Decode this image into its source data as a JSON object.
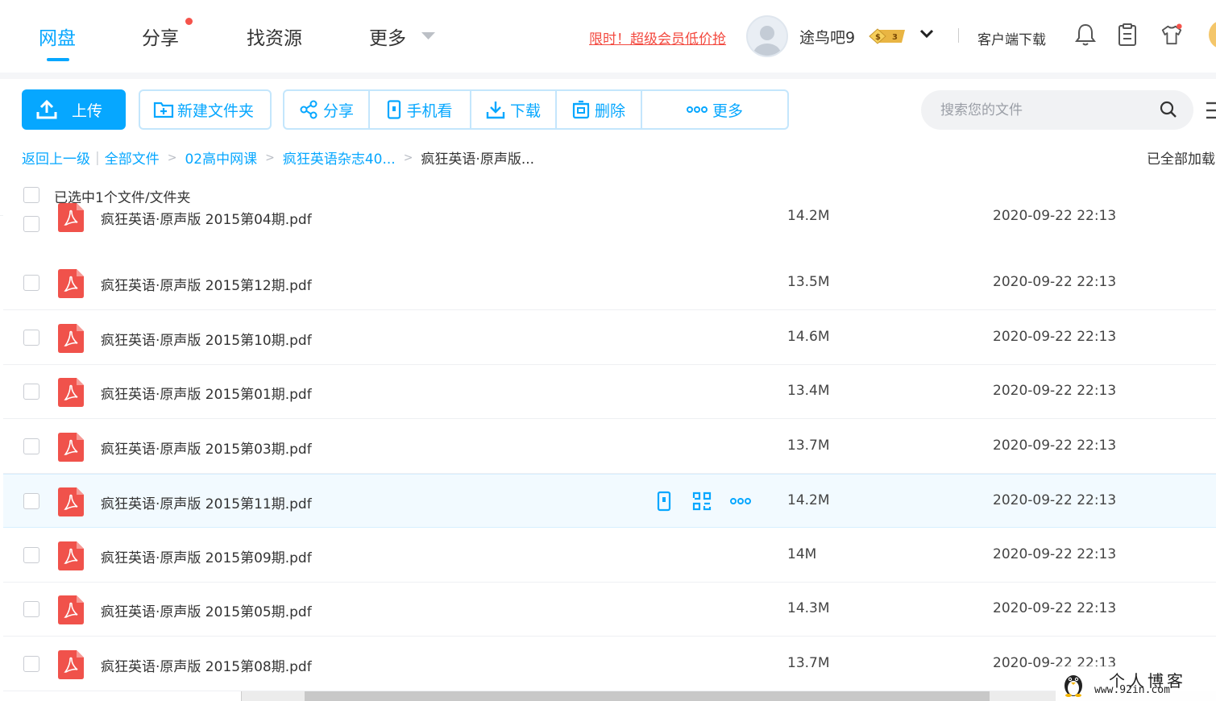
{
  "nav": {
    "tabs": [
      {
        "label": "网盘",
        "active": true
      },
      {
        "label": "分享",
        "has_dot": true
      },
      {
        "label": "找资源"
      },
      {
        "label": "更多"
      }
    ],
    "promo": "限时！超级会员低价抢",
    "username": "途鸟吧9",
    "coin_badge": "3",
    "client_download": "客户端下载",
    "icons": [
      "bell-icon",
      "clipboard-icon",
      "tshirt-icon"
    ]
  },
  "toolbar": {
    "upload": "上传",
    "new_folder": "新建文件夹",
    "share": "分享",
    "mobile_view": "手机看",
    "download": "下载",
    "delete": "删除",
    "more": "更多"
  },
  "search": {
    "placeholder": "搜索您的文件"
  },
  "breadcrumb": {
    "back": "返回上一级",
    "items": [
      "全部文件",
      "02高中网课",
      "疯狂英语杂志40..."
    ],
    "current": "疯狂英语·原声版..."
  },
  "loaded_status": "已全部加载",
  "selection_text": "已选中1个文件/文件夹",
  "files": [
    {
      "name": "疯狂英语·原声版 2015第04期.pdf",
      "size": "14.2M",
      "date": "2020-09-22 22:13"
    },
    {
      "name": "疯狂英语·原声版 2015第12期.pdf",
      "size": "13.5M",
      "date": "2020-09-22 22:13"
    },
    {
      "name": "疯狂英语·原声版 2015第10期.pdf",
      "size": "14.6M",
      "date": "2020-09-22 22:13"
    },
    {
      "name": "疯狂英语·原声版 2015第01期.pdf",
      "size": "13.4M",
      "date": "2020-09-22 22:13"
    },
    {
      "name": "疯狂英语·原声版 2015第03期.pdf",
      "size": "13.7M",
      "date": "2020-09-22 22:13"
    },
    {
      "name": "疯狂英语·原声版 2015第11期.pdf",
      "size": "14.2M",
      "date": "2020-09-22 22:13",
      "hovered": true
    },
    {
      "name": "疯狂英语·原声版 2015第09期.pdf",
      "size": "14M",
      "date": "2020-09-22 22:13"
    },
    {
      "name": "疯狂英语·原声版 2015第05期.pdf",
      "size": "14.3M",
      "date": "2020-09-22 22:13"
    },
    {
      "name": "疯狂英语·原声版 2015第08期.pdf",
      "size": "13.7M",
      "date": "2020-09-22 22:13"
    }
  ],
  "watermark": {
    "line1": "个人博客",
    "line2": "www.92in.com"
  },
  "colors": {
    "accent": "#06a7ff",
    "promo": "#f34a40",
    "pdf": "#f0524b",
    "hover_row": "#f2faff"
  }
}
